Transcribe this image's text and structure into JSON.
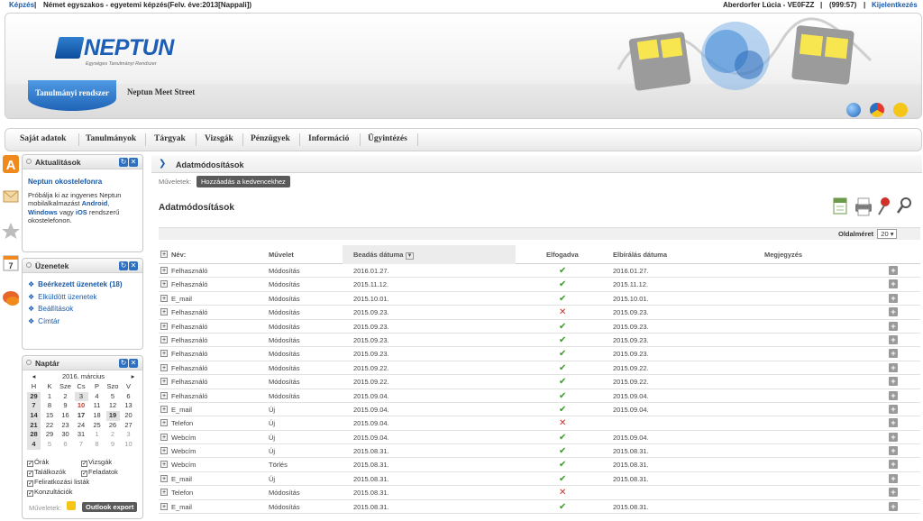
{
  "topbar": {
    "module": "Képzés",
    "program": "Német egyszakos - egyetemi képzés(Felv. éve:2013[Nappali])",
    "user": "Aberdorfer Lúcia - VE0FZZ",
    "timer": "(999:57)",
    "logout": "Kijelentkezés"
  },
  "banner": {
    "logo_word": "NEPTUN",
    "logo_tagline": "Egységes Tanulmányi Rendszer",
    "tab_active": "Tanulmányi rendszer",
    "tab_other": "Neptun Meet Street"
  },
  "menu": [
    "Saját adatok",
    "Tanulmányok",
    "Tárgyak",
    "Vizsgák",
    "Pénzügyek",
    "Információ",
    "Ügyintézés"
  ],
  "news": {
    "title": "Aktualitások",
    "headline": "Neptun okostelefonra",
    "text_1": "Próbálja ki az ingyenes Neptun mobilalkalmazást",
    "android": "Android",
    "text_2": ",",
    "windows": "Windows",
    "text_3": "vagy",
    "ios": "iOS",
    "text_4": "rendszerű okostelefonon."
  },
  "messages": {
    "title": "Üzenetek",
    "items": [
      "Beérkezett üzenetek (18)",
      "Elküldött üzenetek",
      "Beállítások",
      "Címtár"
    ]
  },
  "calendar": {
    "title": "Naptár",
    "month": "2016. március",
    "weekdays": [
      "H",
      "K",
      "Sze",
      "Cs",
      "P",
      "Szo",
      "V"
    ],
    "weeks": [
      [
        "29",
        "1",
        "2",
        "3",
        "4",
        "5",
        "6"
      ],
      [
        "7",
        "8",
        "9",
        "10",
        "11",
        "12",
        "13"
      ],
      [
        "14",
        "15",
        "16",
        "17",
        "18",
        "19",
        "20"
      ],
      [
        "21",
        "22",
        "23",
        "24",
        "25",
        "26",
        "27"
      ],
      [
        "28",
        "29",
        "30",
        "31",
        "1",
        "2",
        "3"
      ],
      [
        "4",
        "5",
        "6",
        "7",
        "8",
        "9",
        "10"
      ]
    ],
    "filters": [
      "Órák",
      "Vizsgák",
      "Találkozók",
      "Feladatok",
      "Feliratkozási listák",
      "Konzultációk"
    ],
    "ops_label": "Műveletek:",
    "export_button": "Outlook export"
  },
  "content": {
    "breadcrumb": "Adatmódosítások",
    "ops_label": "Műveletek:",
    "fav_button": "Hozzáadás a kedvencekhez",
    "title": "Adatmódosítások",
    "pagesize_label": "Oldalméret",
    "pagesize_value": "20",
    "columns": [
      "Név:",
      "Művelet",
      "Beadás dátuma",
      "Elfogadva",
      "Elbírálás dátuma",
      "Megjegyzés"
    ],
    "rows": [
      {
        "name": "Felhasználó",
        "op": "Módosítás",
        "submitted": "2016.01.27.",
        "accepted": true,
        "reviewed": "2016.01.27."
      },
      {
        "name": "Felhasználó",
        "op": "Módosítás",
        "submitted": "2015.11.12.",
        "accepted": true,
        "reviewed": "2015.11.12."
      },
      {
        "name": "E_mail",
        "op": "Módosítás",
        "submitted": "2015.10.01.",
        "accepted": true,
        "reviewed": "2015.10.01."
      },
      {
        "name": "Felhasználó",
        "op": "Módosítás",
        "submitted": "2015.09.23.",
        "accepted": false,
        "reviewed": "2015.09.23."
      },
      {
        "name": "Felhasználó",
        "op": "Módosítás",
        "submitted": "2015.09.23.",
        "accepted": true,
        "reviewed": "2015.09.23."
      },
      {
        "name": "Felhasználó",
        "op": "Módosítás",
        "submitted": "2015.09.23.",
        "accepted": true,
        "reviewed": "2015.09.23."
      },
      {
        "name": "Felhasználó",
        "op": "Módosítás",
        "submitted": "2015.09.23.",
        "accepted": true,
        "reviewed": "2015.09.23."
      },
      {
        "name": "Felhasználó",
        "op": "Módosítás",
        "submitted": "2015.09.22.",
        "accepted": true,
        "reviewed": "2015.09.22."
      },
      {
        "name": "Felhasználó",
        "op": "Módosítás",
        "submitted": "2015.09.22.",
        "accepted": true,
        "reviewed": "2015.09.22."
      },
      {
        "name": "Felhasználó",
        "op": "Módosítás",
        "submitted": "2015.09.04.",
        "accepted": true,
        "reviewed": "2015.09.04."
      },
      {
        "name": "E_mail",
        "op": "Új",
        "submitted": "2015.09.04.",
        "accepted": true,
        "reviewed": "2015.09.04."
      },
      {
        "name": "Telefon",
        "op": "Új",
        "submitted": "2015.09.04.",
        "accepted": false,
        "reviewed": ""
      },
      {
        "name": "Webcím",
        "op": "Új",
        "submitted": "2015.09.04.",
        "accepted": true,
        "reviewed": "2015.09.04."
      },
      {
        "name": "Webcím",
        "op": "Új",
        "submitted": "2015.08.31.",
        "accepted": true,
        "reviewed": "2015.08.31."
      },
      {
        "name": "Webcím",
        "op": "Törlés",
        "submitted": "2015.08.31.",
        "accepted": true,
        "reviewed": "2015.08.31."
      },
      {
        "name": "E_mail",
        "op": "Új",
        "submitted": "2015.08.31.",
        "accepted": true,
        "reviewed": "2015.08.31."
      },
      {
        "name": "Telefon",
        "op": "Módosítás",
        "submitted": "2015.08.31.",
        "accepted": false,
        "reviewed": ""
      },
      {
        "name": "E_mail",
        "op": "Módosítás",
        "submitted": "2015.08.31.",
        "accepted": true,
        "reviewed": "2015.08.31."
      }
    ]
  },
  "icons": {
    "accept": "check-icon",
    "reject": "cross-icon",
    "expand": "plus-icon"
  },
  "colors": {
    "link": "#1a5aa8",
    "accent": "#1f63b6",
    "ok": "#3a9a2a",
    "reject": "#d0302a"
  }
}
